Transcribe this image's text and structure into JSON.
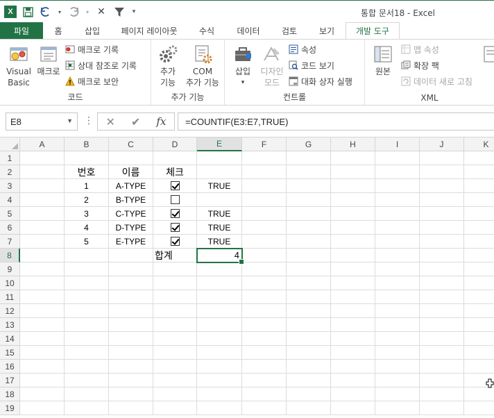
{
  "window": {
    "title": "통합 문서18 - Excel",
    "app_icon": "excel-logo-icon",
    "app_letter": "X",
    "accent": "#217346"
  },
  "qat": [
    {
      "name": "save-icon"
    },
    {
      "name": "undo-icon"
    },
    {
      "name": "redo-icon"
    },
    {
      "name": "close-x-icon"
    },
    {
      "name": "filter-icon"
    },
    {
      "name": "customize-qat-icon"
    }
  ],
  "tabs": [
    "파일",
    "홈",
    "삽입",
    "페이지 레이아웃",
    "수식",
    "데이터",
    "검토",
    "보기",
    "개발 도구"
  ],
  "active_tab": "개발 도구",
  "ribbon": {
    "code": {
      "label": "코드",
      "visual_basic": [
        "Visual",
        "Basic"
      ],
      "macro": "매크로",
      "record_macro": "매크로 기록",
      "relative_ref": "상대 참조로 기록",
      "macro_security": "매크로 보안"
    },
    "addins": {
      "label": "추가 기능",
      "addins_btn": [
        "추가",
        "기능"
      ],
      "com_addins": [
        "COM",
        "추가 기능"
      ]
    },
    "controls": {
      "label": "컨트롤",
      "insert": "삽입",
      "design_mode": [
        "디자인",
        "모드"
      ],
      "properties": "속성",
      "view_code": "코드 보기",
      "run_dialog": "대화 상자 실행"
    },
    "xml": {
      "label": "XML",
      "source": "원본",
      "map_properties": "맵 속성",
      "expansion_packs": "확장 팩",
      "refresh_data": "데이터 새로 고침"
    }
  },
  "formula_bar": {
    "name_box": "E8",
    "formula": "=COUNTIF(E3:E7,TRUE)"
  },
  "columns": [
    "A",
    "B",
    "C",
    "D",
    "E",
    "F",
    "G",
    "H",
    "I",
    "J",
    "K"
  ],
  "rows": [
    "1",
    "2",
    "3",
    "4",
    "5",
    "6",
    "7",
    "8",
    "9",
    "10",
    "11",
    "12",
    "13",
    "14",
    "15",
    "16",
    "17",
    "18",
    "19"
  ],
  "sheet": {
    "headers": {
      "num": "번호",
      "name": "이름",
      "check": "체크"
    },
    "records": [
      {
        "num": "1",
        "name": "A-TYPE",
        "checked": true,
        "result": "TRUE"
      },
      {
        "num": "2",
        "name": "B-TYPE",
        "checked": false,
        "result": ""
      },
      {
        "num": "3",
        "name": "C-TYPE",
        "checked": true,
        "result": "TRUE"
      },
      {
        "num": "4",
        "name": "D-TYPE",
        "checked": true,
        "result": "TRUE"
      },
      {
        "num": "5",
        "name": "E-TYPE",
        "checked": true,
        "result": "TRUE"
      }
    ],
    "total_label": "합계",
    "total_value": "4",
    "selected_cell": "E8"
  }
}
